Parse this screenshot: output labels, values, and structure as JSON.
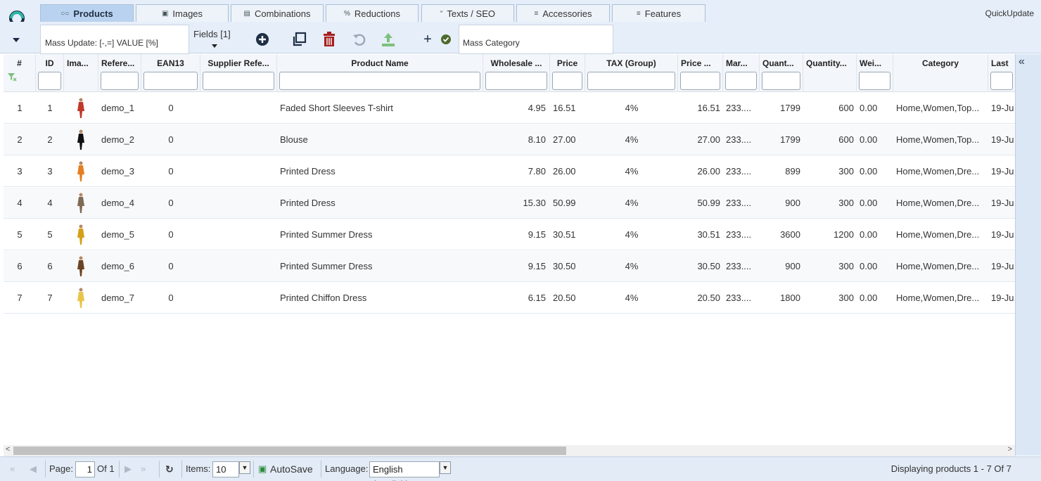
{
  "app": {
    "brand": "QuickUpdate"
  },
  "tabs": [
    {
      "label": "Products",
      "icon": "users-icon",
      "active": true
    },
    {
      "label": "Images",
      "icon": "camera-icon"
    },
    {
      "label": "Combinations",
      "icon": "list-icon"
    },
    {
      "label": "Reductions",
      "icon": "percent-icon"
    },
    {
      "label": "Texts / SEO",
      "icon": "quote-icon"
    },
    {
      "label": "Accessories",
      "icon": "list-ordered-icon"
    },
    {
      "label": "Features",
      "icon": "menu-icon"
    }
  ],
  "toolbar": {
    "mass_update": "Mass Update: [-,=] VALUE [%]",
    "fields": "Fields [1]",
    "mass_category": "Mass Category",
    "plus": "+",
    "colors": {
      "add": "#1f2f45",
      "delete": "#a71f1f",
      "upload": "#7cc07c",
      "check": "#4c6a2f",
      "undo": "#9aa7b6"
    }
  },
  "grid": {
    "headers": [
      "#",
      "ID",
      "Ima...",
      "Refere...",
      "EAN13",
      "Supplier Refe...",
      "Product Name",
      "Wholesale ...",
      "Price",
      "TAX (Group)",
      "Price ...",
      "Mar...",
      "Quant...",
      "Quantity...",
      "Wei...",
      "Category",
      "Last"
    ],
    "rows": [
      {
        "n": "1",
        "id": "1",
        "ref": "demo_1",
        "ean": "0",
        "name": "Faded Short Sleeves T-shirt",
        "wholesale": "4.95",
        "price": "16.51",
        "tax": "4%",
        "price_ti": "16.51",
        "mar": "233....",
        "quant": "1799",
        "quantity": "600",
        "wei": "0.00",
        "category": "Home,Women,Top...",
        "last": "19-Ju"
      },
      {
        "n": "2",
        "id": "2",
        "ref": "demo_2",
        "ean": "0",
        "name": "Blouse",
        "wholesale": "8.10",
        "price": "27.00",
        "tax": "4%",
        "price_ti": "27.00",
        "mar": "233....",
        "quant": "1799",
        "quantity": "600",
        "wei": "0.00",
        "category": "Home,Women,Top...",
        "last": "19-Ju"
      },
      {
        "n": "3",
        "id": "3",
        "ref": "demo_3",
        "ean": "0",
        "name": "Printed Dress",
        "wholesale": "7.80",
        "price": "26.00",
        "tax": "4%",
        "price_ti": "26.00",
        "mar": "233....",
        "quant": "899",
        "quantity": "300",
        "wei": "0.00",
        "category": "Home,Women,Dre...",
        "last": "19-Ju"
      },
      {
        "n": "4",
        "id": "4",
        "ref": "demo_4",
        "ean": "0",
        "name": "Printed Dress",
        "wholesale": "15.30",
        "price": "50.99",
        "tax": "4%",
        "price_ti": "50.99",
        "mar": "233....",
        "quant": "900",
        "quantity": "300",
        "wei": "0.00",
        "category": "Home,Women,Dre...",
        "last": "19-Ju"
      },
      {
        "n": "5",
        "id": "5",
        "ref": "demo_5",
        "ean": "0",
        "name": "Printed Summer Dress",
        "wholesale": "9.15",
        "price": "30.51",
        "tax": "4%",
        "price_ti": "30.51",
        "mar": "233....",
        "quant": "3600",
        "quantity": "1200",
        "wei": "0.00",
        "category": "Home,Women,Dre...",
        "last": "19-Ju"
      },
      {
        "n": "6",
        "id": "6",
        "ref": "demo_6",
        "ean": "0",
        "name": "Printed Summer Dress",
        "wholesale": "9.15",
        "price": "30.50",
        "tax": "4%",
        "price_ti": "30.50",
        "mar": "233....",
        "quant": "900",
        "quantity": "300",
        "wei": "0.00",
        "category": "Home,Women,Dre...",
        "last": "19-Ju"
      },
      {
        "n": "7",
        "id": "7",
        "ref": "demo_7",
        "ean": "0",
        "name": "Printed Chiffon Dress",
        "wholesale": "6.15",
        "price": "20.50",
        "tax": "4%",
        "price_ti": "20.50",
        "mar": "233....",
        "quant": "1800",
        "quantity": "300",
        "wei": "0.00",
        "category": "Home,Women,Dre...",
        "last": "19-Ju"
      }
    ],
    "thumb_colors": [
      "#c0392b",
      "#111111",
      "#e67e22",
      "#7f6a55",
      "#d4a017",
      "#6b4423",
      "#e8c547"
    ]
  },
  "pager": {
    "page_label": "Page:",
    "page_value": "1",
    "of": "Of 1",
    "items_label": "Items:",
    "items_value": "10",
    "autosave": "AutoSave",
    "language_label": "Language:",
    "language_value": "English (English)",
    "status": "Displaying products 1 - 7 Of 7"
  }
}
